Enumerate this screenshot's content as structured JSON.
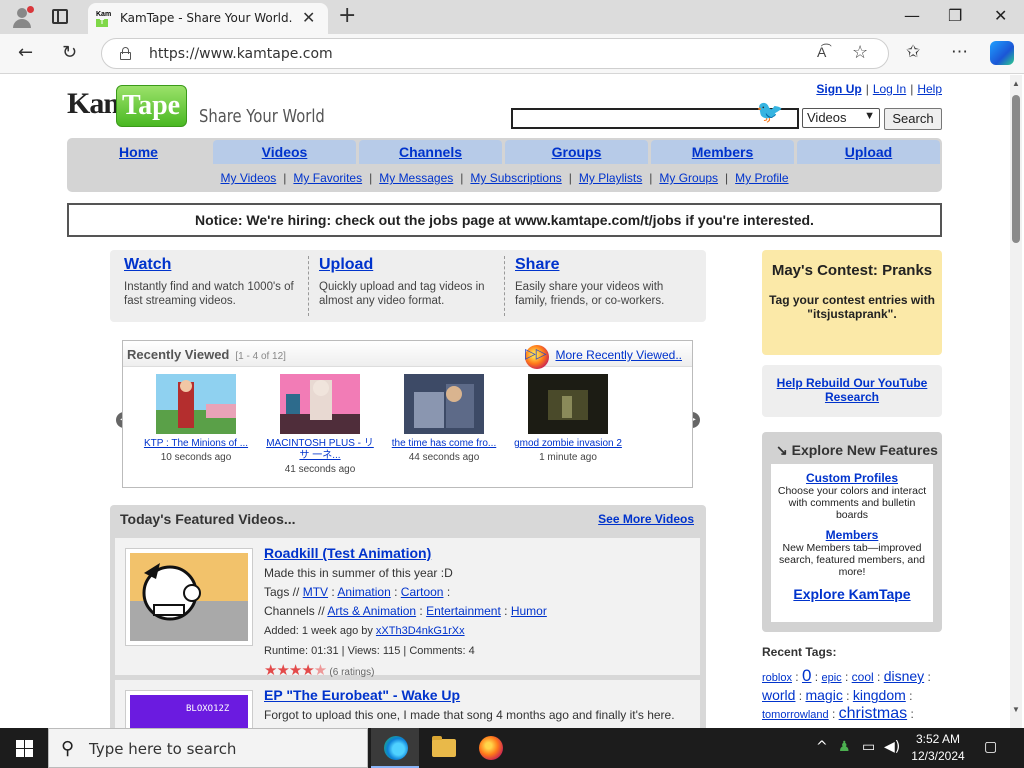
{
  "browser": {
    "tab_title": "KamTape - Share Your World.",
    "tab_close": "✕",
    "new_tab": "+",
    "url": "https://www.kamtape.com",
    "read_aloud": "A͡",
    "window_controls": {
      "minimize": "—",
      "maximize": "❐",
      "close": "✕"
    }
  },
  "header": {
    "logo_kam": "Kam",
    "logo_tape": "Tape",
    "tagline": "Share Your World",
    "links": {
      "signup": "Sign Up",
      "login": "Log In",
      "help": "Help"
    },
    "search": {
      "value": "",
      "category": "Videos",
      "button": "Search"
    }
  },
  "nav": {
    "tabs": [
      "Home",
      "Videos",
      "Channels",
      "Groups",
      "Members",
      "Upload"
    ],
    "active": "Home",
    "sub": [
      "My Videos",
      "My Favorites",
      "My Messages",
      "My Subscriptions",
      "My Playlists",
      "My Groups",
      "My Profile"
    ]
  },
  "notice": "Notice: We're hiring: check out the jobs page at www.kamtape.com/t/jobs if you're interested.",
  "intro": [
    {
      "title": "Watch",
      "text": "Instantly find and watch 1000's of fast streaming videos."
    },
    {
      "title": "Upload",
      "text": "Quickly upload and tag videos in almost any video format."
    },
    {
      "title": "Share",
      "text": "Easily share your videos with family, friends, or co-workers."
    }
  ],
  "recent": {
    "title": "Recently Viewed",
    "count": "[1 - 4 of 12]",
    "more": "More Recently Viewed..",
    "items": [
      {
        "title": "KTP : The Minions of ...",
        "ago": "10 seconds ago"
      },
      {
        "title": "MACINTOSH PLUS - リサ 一ネ...",
        "ago": "41 seconds ago"
      },
      {
        "title": "the time has come fro...",
        "ago": "44 seconds ago"
      },
      {
        "title": "gmod zombie invasion 2",
        "ago": "1 minute ago"
      }
    ]
  },
  "featured": {
    "title": "Today's Featured Videos...",
    "more": "See More Videos",
    "items": [
      {
        "title": "Roadkill (Test Animation)",
        "desc": "Made this in summer of this year :D",
        "tags_label": "Tags //",
        "tags": [
          "MTV",
          "Animation",
          "Cartoon"
        ],
        "channels_label": "Channels //",
        "channels": [
          "Arts & Animation",
          "Entertainment",
          "Humor"
        ],
        "added": "Added: 1 week ago by",
        "user": "xXTh3D4nkG1rXx",
        "stats": "Runtime: 01:31 | Views: 115 | Comments: 4",
        "rating": 4.5,
        "ratings": "(6 ratings)"
      },
      {
        "title": "EP \"The Eurobeat\" - Wake Up",
        "desc": "Forgot to upload this one, I made that song 4 months ago and finally it's here.",
        "thumb_text": "BLOXO12Z"
      }
    ]
  },
  "sidebar": {
    "contest": {
      "title": "May's Contest: Pranks",
      "text": "Tag your contest entries with \"itsjustaprank\"."
    },
    "rebuild": "Help Rebuild Our YouTube Research",
    "explore": {
      "title": "Explore New Features",
      "features": [
        {
          "name": "Custom Profiles",
          "desc": "Choose your colors and interact with comments and bulletin boards"
        },
        {
          "name": "Members",
          "desc": "New Members tab—improved search, featured members, and more!"
        }
      ],
      "cta": "Explore KamTape"
    },
    "recent_tags_title": "Recent Tags:",
    "tags": [
      "roblox",
      "0",
      "epic",
      "cool",
      "disney",
      "world",
      "magic",
      "kingdom",
      "tomorrowland",
      "christmas"
    ]
  },
  "taskbar": {
    "search_placeholder": "Type here to search",
    "time": "3:52 AM",
    "date": "12/3/2024"
  },
  "colors": {
    "nav_tab": "#b7cbe8",
    "link": "#0033cc",
    "logo_green": "#4ab823",
    "contest_bg": "#fbe9a8",
    "star": "#e34a4a"
  }
}
